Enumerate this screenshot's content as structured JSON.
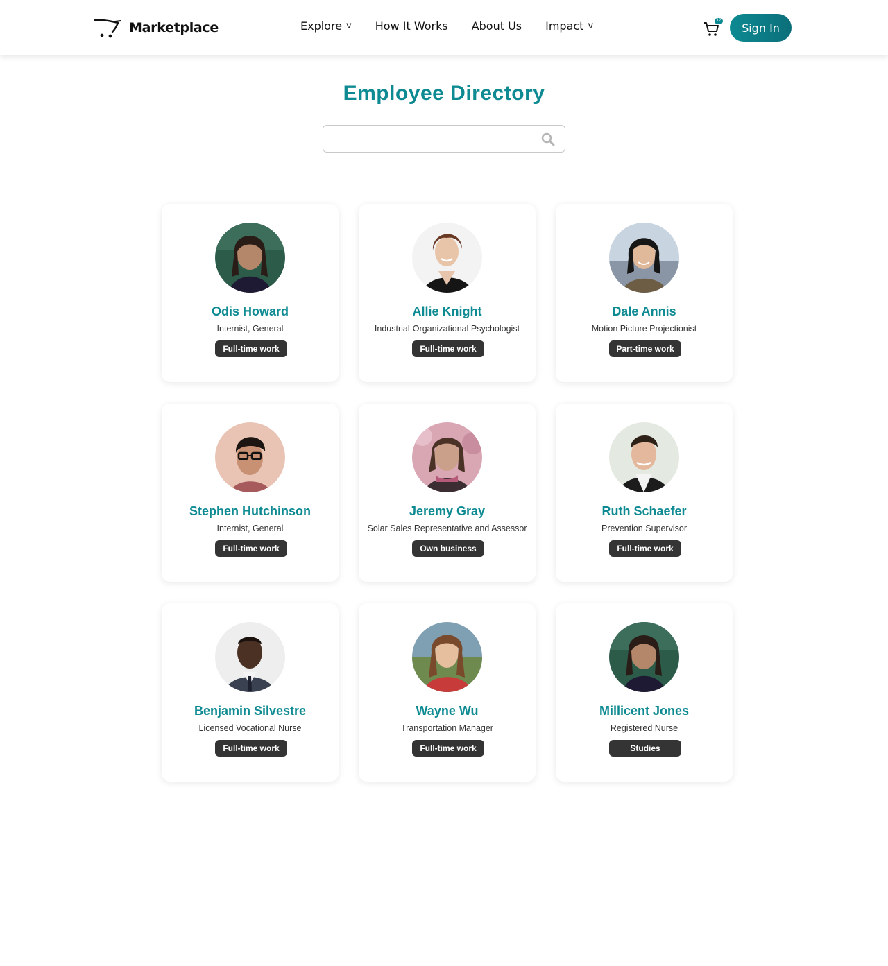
{
  "header": {
    "brand": "Marketplace",
    "nav": [
      {
        "label": "Explore",
        "has_dropdown": true
      },
      {
        "label": "How It Works",
        "has_dropdown": false
      },
      {
        "label": "About Us",
        "has_dropdown": false
      },
      {
        "label": "Impact",
        "has_dropdown": true
      }
    ],
    "dropdown_caret": "v",
    "cart_badge": "12",
    "cart_icon": "shopping-cart-icon",
    "sign_in_label": "Sign In"
  },
  "main": {
    "title": "Employee Directory",
    "search": {
      "value": "",
      "placeholder": "",
      "icon": "search-icon"
    }
  },
  "colors": {
    "accent": "#0e8a92",
    "tag_bg": "#343434",
    "header_bg": "#ffffff"
  },
  "employees": [
    {
      "name": "Odis Howard",
      "role": "Internist, General",
      "tag": "Full-time work",
      "photo": "person-photo"
    },
    {
      "name": "Allie Knight",
      "role": "Industrial-Organizational Psychologist",
      "tag": "Full-time work",
      "photo": "person-photo"
    },
    {
      "name": "Dale Annis",
      "role": "Motion Picture Projectionist",
      "tag": "Part-time work",
      "photo": "person-photo"
    },
    {
      "name": "Stephen Hutchinson",
      "role": "Internist, General",
      "tag": "Full-time work",
      "photo": "person-photo"
    },
    {
      "name": "Jeremy Gray",
      "role": "Solar Sales Representative and Assessor",
      "tag": "Own business",
      "photo": "person-photo"
    },
    {
      "name": "Ruth Schaefer",
      "role": "Prevention Supervisor",
      "tag": "Full-time work",
      "photo": "person-photo"
    },
    {
      "name": "Benjamin Silvestre",
      "role": "Licensed Vocational Nurse",
      "tag": "Full-time work",
      "photo": "person-photo"
    },
    {
      "name": "Wayne Wu",
      "role": "Transportation Manager",
      "tag": "Full-time work",
      "photo": "person-photo"
    },
    {
      "name": "Millicent Jones",
      "role": "Registered Nurse",
      "tag": "Studies",
      "photo": "person-photo"
    }
  ]
}
